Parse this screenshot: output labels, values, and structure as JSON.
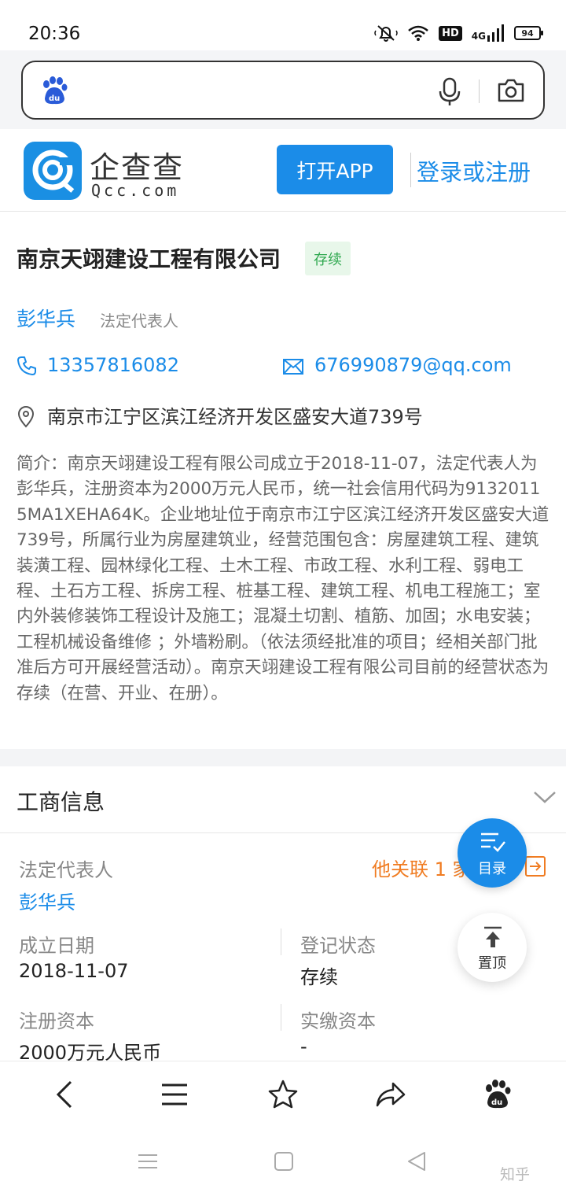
{
  "status_bar": {
    "time": "20:36",
    "hd_label": "HD",
    "network_label": "4G",
    "battery": "94"
  },
  "site_header": {
    "logo_cn": "企查查",
    "logo_en": "Qcc.com",
    "open_app_label": "打开APP",
    "login_label": "登录或注册"
  },
  "company": {
    "name": "南京天翊建设工程有限公司",
    "status": "存续",
    "legal_rep_name": "彭华兵",
    "legal_rep_label": "法定代表人",
    "phone": "13357816082",
    "email": "676990879@qq.com",
    "address": "南京市江宁区滨江经济开发区盛安大道739号",
    "intro": "简介：南京天翊建设工程有限公司成立于2018-11-07，法定代表人为彭华兵，注册资本为2000万元人民币，统一社会信用代码为91320115MA1XEHA64K。企业地址位于南京市江宁区滨江经济开发区盛安大道739号，所属行业为房屋建筑业，经营范围包含：房屋建筑工程、建筑装潢工程、园林绿化工程、土木工程、市政工程、水利工程、弱电工程、土石方工程、拆房工程、桩基工程、建筑工程、机电工程施工；室内外装修装饰工程设计及施工；混凝土切割、植筋、加固；水电安装；工程机械设备维修 ；外墙粉刷。（依法须经批准的项目；经相关部门批准后方可开展经营活动）。南京天翊建设工程有限公司目前的经营状态为存续（在营、开业、在册）。"
  },
  "business_info": {
    "title": "工商信息",
    "legal_rep_label": "法定代表人",
    "legal_rep_value": "彭华兵",
    "related_link": "他关联 1 家",
    "founded_label": "成立日期",
    "founded_value": "2018-11-07",
    "reg_status_label": "登记状态",
    "reg_status_value": "存续",
    "reg_capital_label": "注册资本",
    "reg_capital_value": "2000万元人民币",
    "paid_capital_label": "实缴资本",
    "paid_capital_value": "-"
  },
  "floating": {
    "toc_label": "目录",
    "top_label": "置顶"
  },
  "watermark": "知乎",
  "colors": {
    "accent": "#1b8ce8",
    "status_green": "#2fa84f",
    "related_orange": "#f07c22"
  }
}
